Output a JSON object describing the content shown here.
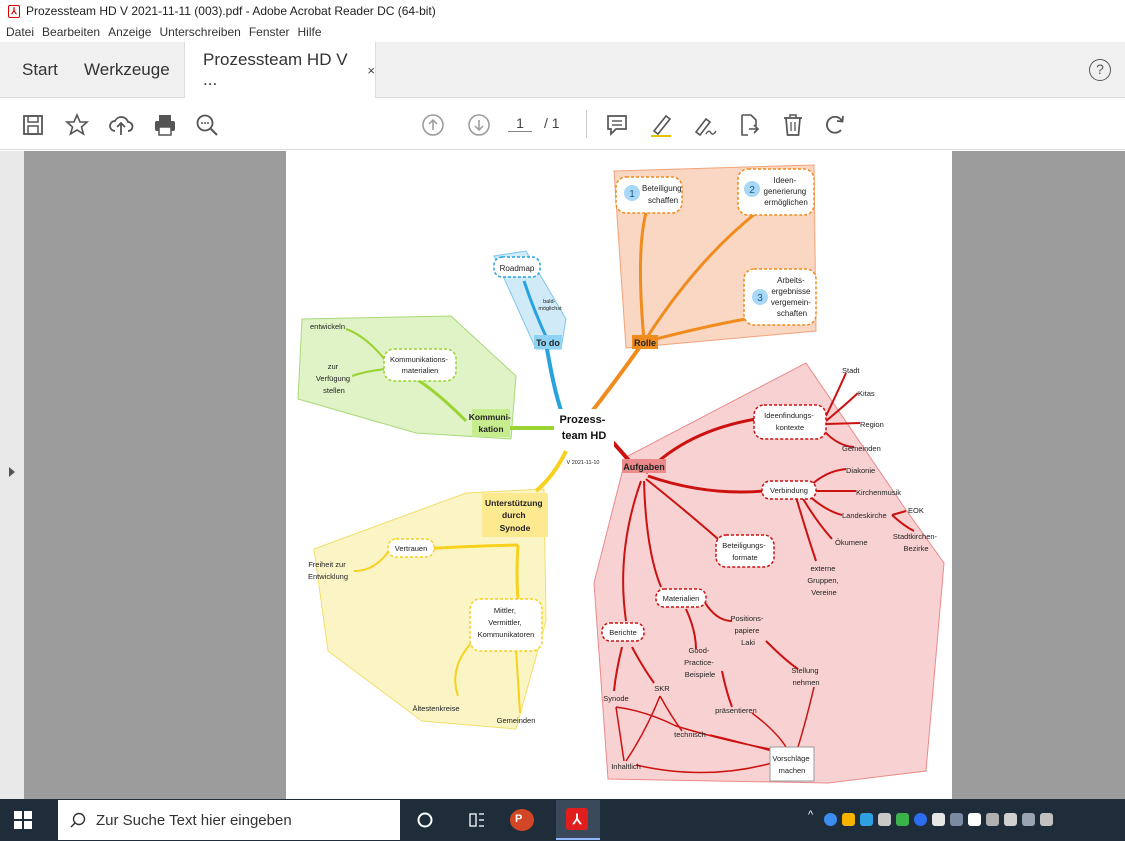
{
  "window": {
    "title": "Prozessteam HD V 2021-11-11 (003).pdf - Adobe Acrobat Reader DC (64-bit)"
  },
  "menu": [
    "Datei",
    "Bearbeiten",
    "Anzeige",
    "Unterschreiben",
    "Fenster",
    "Hilfe"
  ],
  "tabs": {
    "start": "Start",
    "tools": "Werkzeuge",
    "doc": "Prozessteam HD V ...",
    "close": "×",
    "help": "?"
  },
  "toolbar": {
    "page_current": "1",
    "page_total": "/ 1"
  },
  "colors": {
    "orange": "#f08c1e",
    "blue": "#29a3e0",
    "green": "#9bd432",
    "yellow": "#f7d11e",
    "red": "#cc1111"
  },
  "mindmap": {
    "center": [
      "Prozess-",
      "team HD"
    ],
    "version": "V 2021-11-10",
    "rolle": {
      "label": "Rolle",
      "beteiligung": [
        "Beteiligung",
        "schaffen"
      ],
      "ideen": [
        "Ideen-",
        "generierung",
        "ermöglichen"
      ],
      "arbeits": [
        "Arbeits-",
        "ergebnisse",
        "vergemein-",
        "schaften"
      ],
      "n1": "1",
      "n2": "2",
      "n3": "3"
    },
    "todo": {
      "label": "To do",
      "roadmap": "Roadmap",
      "bald": [
        "bald-",
        "möglichst"
      ]
    },
    "kommunikation": {
      "label": [
        "Kommuni-",
        "kation"
      ],
      "materialien": [
        "Kommunikations-",
        "materialien"
      ],
      "entwickeln": "entwickeln",
      "zur": [
        "zur",
        "Verfügung",
        "stellen"
      ]
    },
    "unterstuetzung": {
      "label": [
        "Unterstützung",
        "durch",
        "Synode"
      ],
      "vertrauen": "Vertrauen",
      "freiheit": [
        "Freiheit zur",
        "Entwicklung"
      ],
      "mittler": [
        "Mittler,",
        "Vermittler,",
        "Kommunikatoren"
      ],
      "aeltesten": "Ältestenkreise",
      "gemeinden": "Gemeinden"
    },
    "aufgaben": {
      "label": "Aufgaben",
      "ideenfindung": [
        "Ideenfindungs-",
        "kontexte"
      ],
      "stadt": "Stadt",
      "kitas": "Kitas",
      "region": "Region",
      "gemeinden": "Gemeinden",
      "verbindung": "Verbindung",
      "diakonie": "Diakonie",
      "kirchenmusik": "Kirchenmusik",
      "landeskirche": "Landeskirche",
      "eok": "EOK",
      "stadtkirchen": [
        "Stadtkirchen-",
        "Bezirke"
      ],
      "oekumene": "Ökumene",
      "externe": [
        "externe",
        "Gruppen,",
        "Vereine"
      ],
      "beteiligungsformate": [
        "Beteiligungs-",
        "formate"
      ],
      "materialien": "Materialien",
      "positions": [
        "Positions-",
        "papiere",
        "Laki"
      ],
      "good": [
        "Good-",
        "Practice-",
        "Beispiele"
      ],
      "stellung": [
        "Stellung",
        "nehmen"
      ],
      "berichte": "Berichte",
      "synode": "Synode",
      "skr": "SKR",
      "praesentieren": "präsentieren",
      "technisch": "technisch",
      "inhaltlich": "Inhaltlich",
      "vorschlaege": [
        "Vorschläge",
        "machen"
      ]
    }
  },
  "taskbar": {
    "search_placeholder": "Zur Suche Text hier eingeben"
  }
}
